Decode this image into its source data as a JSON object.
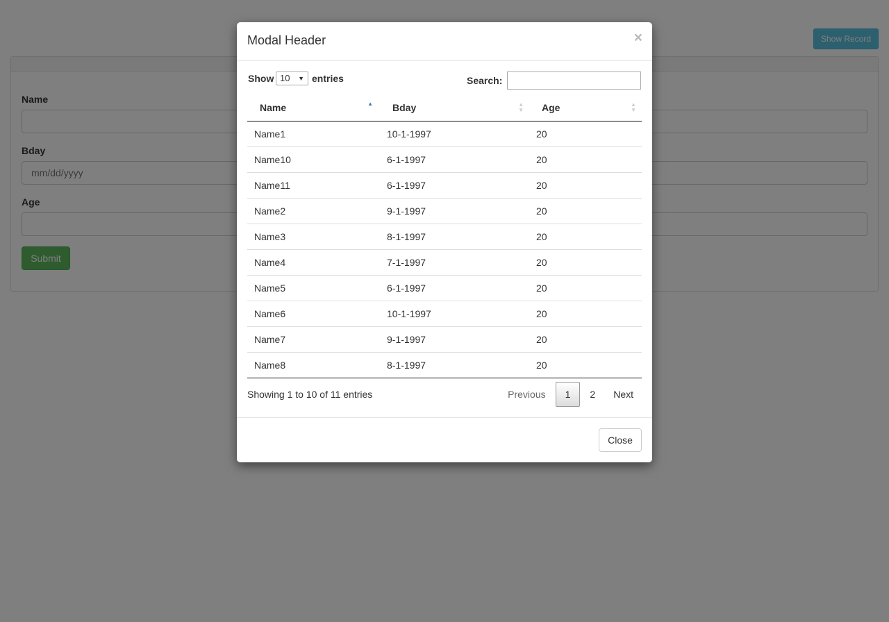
{
  "background_page": {
    "show_record_label": "Show Record",
    "form": {
      "name_label": "Name",
      "bday_label": "Bday",
      "bday_placeholder": "mm/dd/yyyy",
      "age_label": "Age",
      "submit_label": "Submit"
    }
  },
  "modal": {
    "title": "Modal Header",
    "close_icon": "×",
    "length": {
      "show_label": "Show",
      "selected": "10",
      "caret": "▼",
      "entries_label": "entries"
    },
    "search_label": "Search:",
    "columns": [
      "Name",
      "Bday",
      "Age"
    ],
    "rows": [
      [
        "Name1",
        "10-1-1997",
        "20"
      ],
      [
        "Name10",
        "6-1-1997",
        "20"
      ],
      [
        "Name11",
        "6-1-1997",
        "20"
      ],
      [
        "Name2",
        "9-1-1997",
        "20"
      ],
      [
        "Name3",
        "8-1-1997",
        "20"
      ],
      [
        "Name4",
        "7-1-1997",
        "20"
      ],
      [
        "Name5",
        "6-1-1997",
        "20"
      ],
      [
        "Name6",
        "10-1-1997",
        "20"
      ],
      [
        "Name7",
        "9-1-1997",
        "20"
      ],
      [
        "Name8",
        "8-1-1997",
        "20"
      ]
    ],
    "info": "Showing 1 to 10 of 11 entries",
    "pagination": {
      "previous": "Previous",
      "pages": [
        "1",
        "2"
      ],
      "current": "1",
      "next": "Next"
    },
    "footer_close_label": "Close"
  },
  "colors": {
    "info_button": "#5bc0de",
    "success_button": "#5cb85c",
    "sort_active": "#337ab7"
  }
}
